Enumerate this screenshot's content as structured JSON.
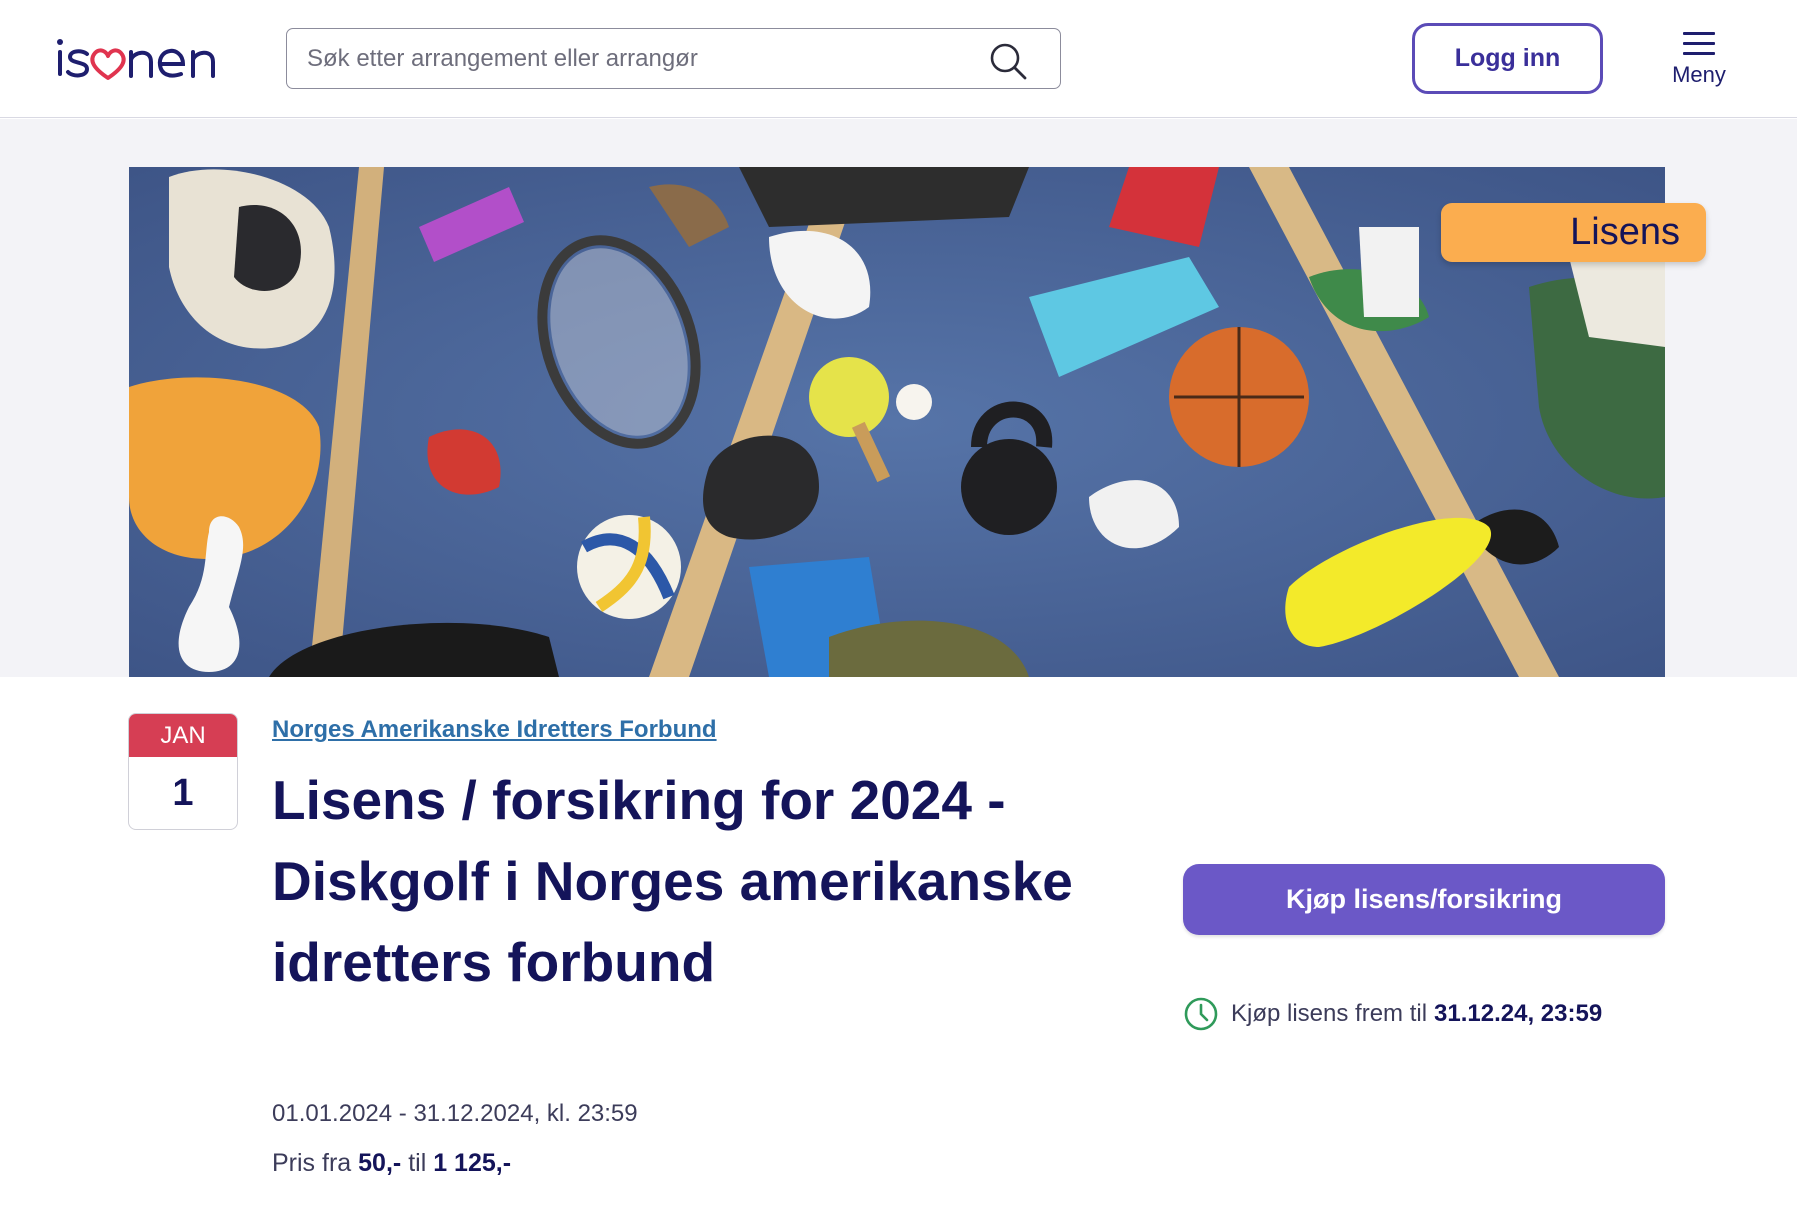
{
  "header": {
    "logo_text": "isonen",
    "search_placeholder": "Søk etter arrangement eller arrangør",
    "login_label": "Logg inn",
    "menu_label": "Meny"
  },
  "hero": {
    "tag_label": "Lisens",
    "tag_color": "#fbad4f"
  },
  "event": {
    "date_month": "JAN",
    "date_day": "1",
    "organizer": "Norges Amerikanske Idretters Forbund",
    "title": "Lisens / forsikring for 2024 - Diskgolf i Norges amerikanske idretters forbund",
    "date_range": "01.01.2024 - 31.12.2024, kl. 23:59",
    "price_prefix": "Pris fra",
    "price_from": "50,-",
    "price_sep": "til",
    "price_to": "1 125,-"
  },
  "actions": {
    "buy_label": "Kjøp lisens/forsikring",
    "buy_color": "#6b58c7",
    "deadline_prefix": "Kjøp lisens frem til",
    "deadline_value": "31.12.24, 23:59"
  },
  "icons": {
    "search": "search-icon",
    "menu": "hamburger-menu-icon",
    "clock": "clock-icon",
    "logo_heart": "heart-icon"
  }
}
